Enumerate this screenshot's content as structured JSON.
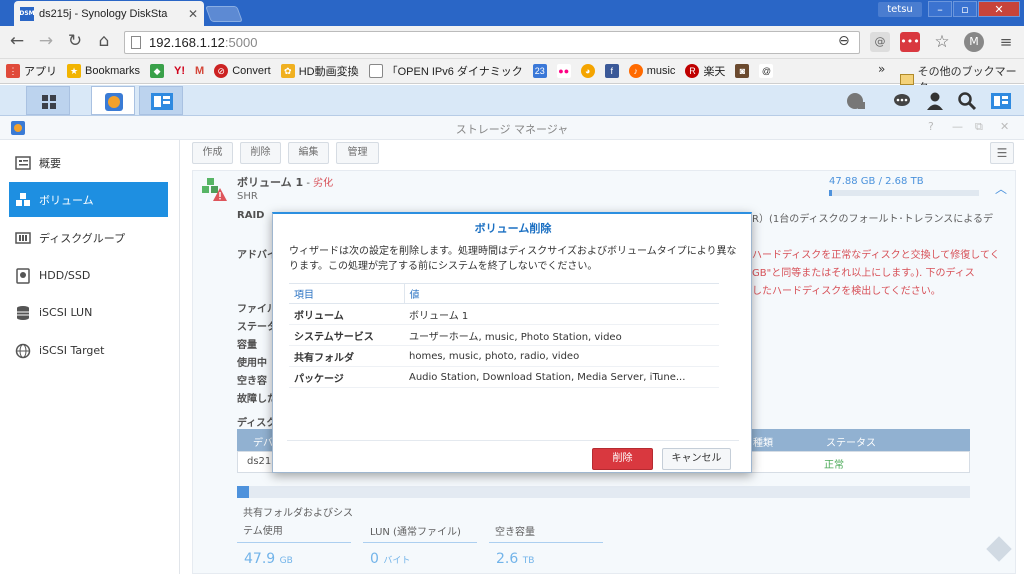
{
  "browser": {
    "tab_title": "ds215j - Synology DiskSta",
    "tab_favicon": "DSM",
    "user": "tetsu",
    "url_host": "192.168.1.12",
    "url_port": ":5000",
    "bookmarks": [
      {
        "label": "アプリ",
        "icon": "apps-grid-icon",
        "color": "#e04a3a"
      },
      {
        "label": "Bookmarks",
        "icon": "star-icon",
        "color": "#f2b400"
      },
      {
        "label": "",
        "icon": "green-diamond-icon",
        "color": "#3aa14a"
      },
      {
        "label": "Y!",
        "icon": "yahoo-icon",
        "color": "#d0021b"
      },
      {
        "label": "M",
        "icon": "gmail-icon",
        "color": "#d44638"
      },
      {
        "label": "Convert",
        "icon": "convert-icon",
        "color": "#cc2222"
      },
      {
        "label": "HD動画変換",
        "icon": "video-icon",
        "color": "#f0b020"
      },
      {
        "label": "「OPEN IPv6 ダイナミック",
        "icon": "page-icon",
        "color": "#888888"
      },
      {
        "label": "23",
        "icon": "calendar-icon",
        "color": "#3a78d8"
      },
      {
        "label": "",
        "icon": "flickr-icon",
        "color": "#ff0084"
      },
      {
        "label": "",
        "icon": "picasa-icon",
        "color": "#f4a400"
      },
      {
        "label": "",
        "icon": "facebook-icon",
        "color": "#3b5998"
      },
      {
        "label": "music",
        "icon": "music-icon",
        "color": "#ff6a00"
      },
      {
        "label": "楽天",
        "icon": "rakuten-icon",
        "color": "#bf0000"
      },
      {
        "label": "",
        "icon": "instagram-icon",
        "color": "#6b4a2f"
      },
      {
        "label": "",
        "icon": "spiral-icon",
        "color": "#555555"
      }
    ],
    "other_bookmarks": "その他のブックマーク"
  },
  "window": {
    "title": "ストレージ マネージャ"
  },
  "sidebar": {
    "items": [
      {
        "label": "概要",
        "icon": "overview-icon"
      },
      {
        "label": "ボリューム",
        "icon": "volume-icon"
      },
      {
        "label": "ディスクグループ",
        "icon": "disk-group-icon"
      },
      {
        "label": "HDD/SSD",
        "icon": "hdd-icon"
      },
      {
        "label": "iSCSI LUN",
        "icon": "iscsi-lun-icon"
      },
      {
        "label": "iSCSI Target",
        "icon": "iscsi-target-icon"
      }
    ]
  },
  "toolbar": {
    "create": "作成",
    "delete": "削除",
    "edit": "編集",
    "manage": "管理"
  },
  "volume": {
    "name": "ボリューム 1",
    "status_sep": " - ",
    "status": "劣化",
    "type": "SHR",
    "usage": "47.88 GB / 2.68 TB",
    "usage_fraction": 0.017,
    "raid_label": "RAID",
    "raid_tail": "R）(1台のディスクのフォールト･トレランスによるデ",
    "advice_label": "アドバイ",
    "advice_lines": [
      "ハードディスクを正常なディスクと交換して修復してく",
      "GB\"と同等またはそれ以上にします。). 下のディス",
      "したハードディスクを検出してください。"
    ],
    "info_labels": [
      "ファイル",
      "ステータ",
      "容量",
      "使用中",
      "空き容",
      "故障した"
    ],
    "disk_section": "ディスク",
    "table_headers": [
      "デバ",
      "種類",
      "ステータス"
    ],
    "table_row": [
      "ds21",
      "",
      "正常"
    ],
    "stats": [
      {
        "label": "共有フォルダおよびシステム使用",
        "value": "47.9",
        "unit": "GB"
      },
      {
        "label": "LUN (通常ファイル)",
        "value": "0",
        "unit": "バイト"
      },
      {
        "label": "空き容量",
        "value": "2.6",
        "unit": "TB"
      }
    ],
    "usage_bar_fraction": 0.016
  },
  "modal": {
    "title": "ボリューム削除",
    "description": "ウィザードは次の設定を削除します。処理時間はディスクサイズおよびボリュームタイプにより異なります。この処理が完了する前にシステムを終了しないでください。",
    "col_item": "項目",
    "col_value": "値",
    "rows": [
      {
        "key": "ボリューム",
        "value": "ボリューム 1"
      },
      {
        "key": "システムサービス",
        "value": "ユーザーホーム, music, Photo Station, video"
      },
      {
        "key": "共有フォルダ",
        "value": "homes, music, photo, radio, video"
      },
      {
        "key": "パッケージ",
        "value": "Audio Station, Download Station, Media Server, iTune..."
      }
    ],
    "delete_label": "削除",
    "cancel_label": "キャンセル"
  }
}
